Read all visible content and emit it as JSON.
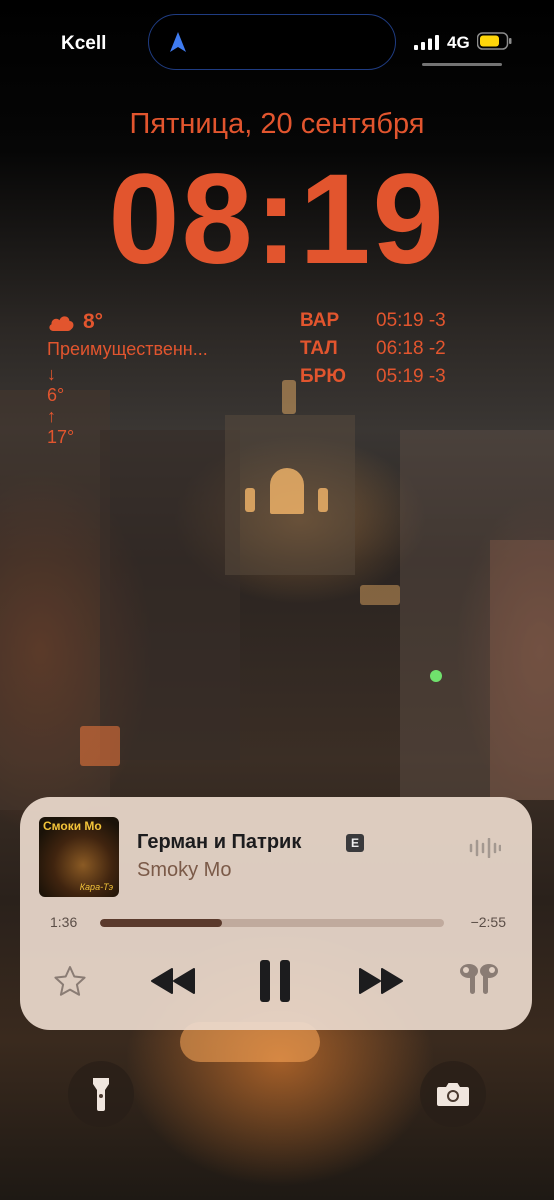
{
  "status_bar": {
    "carrier": "Kcell",
    "network": "4G",
    "icons": [
      "location-arrow-icon",
      "signal-bars-icon",
      "battery-icon"
    ]
  },
  "lock_screen": {
    "date": "Пятница, 20 сентября",
    "time": "08:19",
    "accent_color": "#e2552e"
  },
  "weather_widget": {
    "icon": "cloud-icon",
    "temperature": "8°",
    "condition": "Преимущественн...",
    "low": "6°",
    "high": "17°"
  },
  "world_clock_widget": {
    "rows": [
      {
        "city": "ВАР",
        "time": "05:19 -3"
      },
      {
        "city": "ТАЛ",
        "time": "06:18 -2"
      },
      {
        "city": "БРЮ",
        "time": "05:19 -3"
      }
    ]
  },
  "now_playing": {
    "album_cover": {
      "title": "Смоки Мо",
      "subtitle": "Кара-Тэ"
    },
    "song_title": "Герман и Патрик",
    "explicit_badge": "E",
    "artist": "Smoky Mo",
    "elapsed": "1:36",
    "remaining": "−2:55",
    "progress_fraction": 0.355,
    "controls": [
      "star-icon",
      "rewind-icon",
      "pause-icon",
      "fast-forward-icon",
      "airpods-icon"
    ]
  },
  "quick_actions": {
    "left": "flashlight-icon",
    "right": "camera-icon"
  }
}
